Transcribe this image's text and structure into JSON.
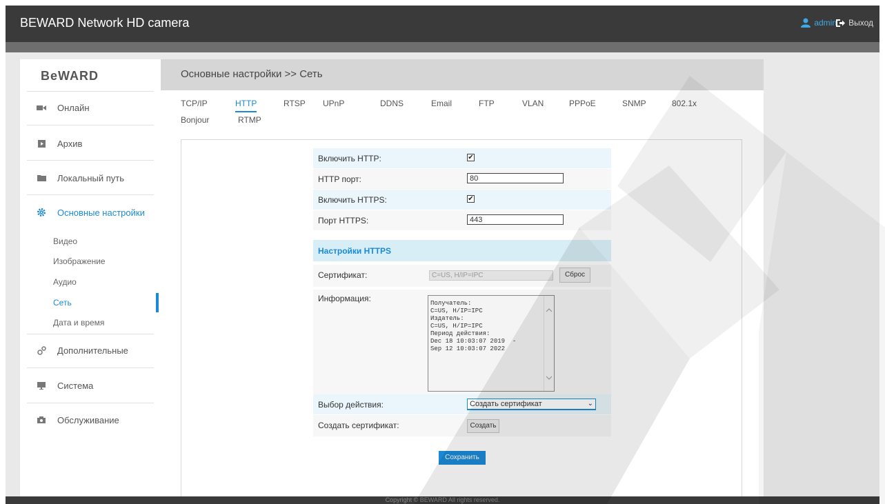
{
  "header": {
    "title": "BEWARD Network HD camera",
    "user": "admin",
    "logout": "Выход"
  },
  "footer": {
    "copyright": "Copyright © BEWARD All rights reserved."
  },
  "sidebar": {
    "logo": "BeWARD",
    "items": [
      {
        "label": "Онлайн",
        "icon": "video-camera-icon"
      },
      {
        "label": "Архив",
        "icon": "play-icon"
      },
      {
        "label": "Локальный путь",
        "icon": "folder-icon"
      },
      {
        "label": "Основные настройки",
        "icon": "gear-icon",
        "active": true
      },
      {
        "label": "Дополнительные",
        "icon": "gears-icon"
      },
      {
        "label": "Система",
        "icon": "monitor-icon"
      },
      {
        "label": "Обслуживание",
        "icon": "camera-icon"
      }
    ],
    "subitems": [
      {
        "label": "Видео"
      },
      {
        "label": "Изображение"
      },
      {
        "label": "Аудио"
      },
      {
        "label": "Сеть",
        "active": true
      },
      {
        "label": "Дата и время"
      }
    ]
  },
  "breadcrumb": "Основные настройки >> Сеть",
  "tabs": [
    "TCP/IP",
    "HTTP",
    "RTSP",
    "UPnP",
    "DDNS",
    "Email",
    "FTP",
    "VLAN",
    "PPPoE",
    "SNMP",
    "802.1x",
    "Bonjour",
    "RTMP"
  ],
  "active_tab": "HTTP",
  "form": {
    "enable_http_label": "Включить HTTP:",
    "enable_http_checked": true,
    "http_port_label": "HTTP порт:",
    "http_port_value": "80",
    "enable_https_label": "Включить HTTPS:",
    "enable_https_checked": true,
    "https_port_label": "Порт HTTPS:",
    "https_port_value": "443",
    "https_section_title": "Настройки HTTPS",
    "certificate_label": "Сертификат:",
    "certificate_value": "C=US, H/IP=IPC",
    "reset_button": "Сброс",
    "info_label": "Информация:",
    "info_text": "Получатель:\nC=US, H/IP=IPC\nИздатель:\nC=US, H/IP=IPC\nПериод действия:\nDec 18 10:03:07 2019  -\nSep 12 10:03:07 2022",
    "action_label": "Выбор действия:",
    "action_value": "Создать сертификат",
    "create_cert_label": "Создать сертификат:",
    "create_button": "Создать",
    "save_button": "Сохранить"
  },
  "colors": {
    "accent": "#1b8ad6",
    "topbar": "#3a3a3a",
    "section_bg": "#d8eef7"
  }
}
